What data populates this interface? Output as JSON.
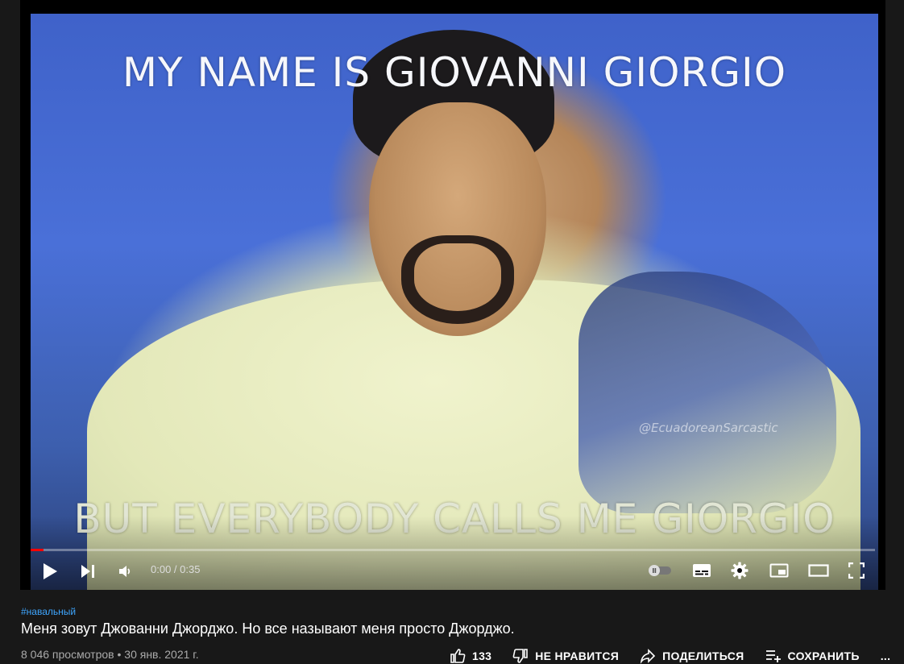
{
  "video": {
    "caption_top": "MY NAME IS GIOVANNI GIORGIO",
    "caption_bottom": "BUT EVERYBODY CALLS ME GIORGIO",
    "watermark": "@EcuadoreanSarcastic",
    "progress": 0
  },
  "controls": {
    "time": "0:00 / 0:35"
  },
  "info": {
    "hashtag": "#навальный",
    "title": "Меня зовут Джованни Джорджо. Но все называют меня просто Джорджо.",
    "meta": "8 046 просмотров • 30 янв. 2021 г."
  },
  "actions": {
    "like_count": "133",
    "dislike_label": "НЕ НРАВИТСЯ",
    "share_label": "ПОДЕЛИТЬСЯ",
    "save_label": "СОХРАНИТЬ",
    "more_label": "..."
  },
  "colors": {
    "background": "#181818",
    "accent": "#ff0000",
    "link": "#3ea6ff"
  }
}
